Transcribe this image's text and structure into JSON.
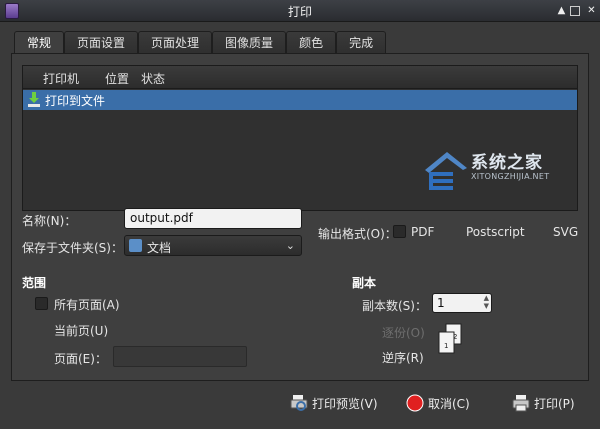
{
  "window": {
    "title": "打印"
  },
  "tabs": [
    {
      "label": "常规",
      "active": true
    },
    {
      "label": "页面设置"
    },
    {
      "label": "页面处理"
    },
    {
      "label": "图像质量"
    },
    {
      "label": "颜色"
    },
    {
      "label": "完成"
    }
  ],
  "printer_list": {
    "columns": [
      "打印机",
      "位置",
      "状态"
    ],
    "rows": [
      {
        "name": "打印到文件",
        "selected": true
      }
    ]
  },
  "watermark": {
    "text": "系统之家",
    "sub": "XITONGZHIJIA.NET"
  },
  "file": {
    "name_label": "名称(N)：",
    "name_value": "output.pdf",
    "folder_label": "保存于文件夹(S)：",
    "folder_value": "文档"
  },
  "output_format": {
    "label": "输出格式(O)：",
    "options": [
      "PDF",
      "Postscript",
      "SVG"
    ],
    "selected": "PDF"
  },
  "range": {
    "title": "范围",
    "all_pages": "所有页面(A)",
    "current_page": "当前页(U)",
    "pages_label": "页面(E)："
  },
  "copies": {
    "title": "副本",
    "count_label": "副本数(S)：",
    "count_value": "1",
    "collate_label": "逐份(O)",
    "reverse_label": "逆序(R)"
  },
  "buttons": {
    "preview": "打印预览(V)",
    "cancel": "取消(C)",
    "print": "打印(P)"
  },
  "colors": {
    "selection": "#3a6ea8",
    "background": "#3f3f3f"
  }
}
